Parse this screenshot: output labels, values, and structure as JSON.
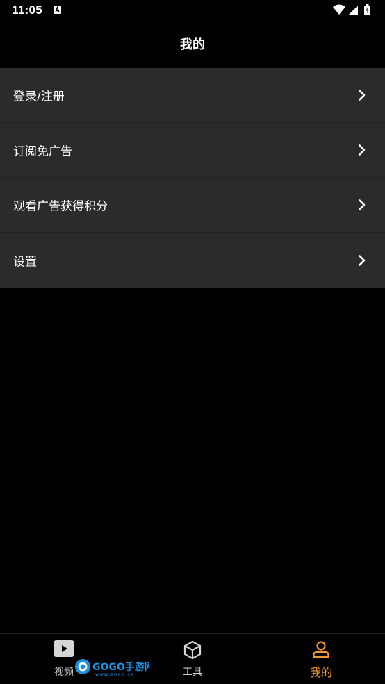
{
  "status_bar": {
    "time": "11:05",
    "notification_icon": "a-notification-icon",
    "wifi_icon": "wifi-icon",
    "signal_icon": "signal-icon",
    "battery_icon": "battery-charging-icon"
  },
  "header": {
    "title": "我的"
  },
  "menu": {
    "items": [
      {
        "label": "登录/注册",
        "icon": "chevron-right-icon"
      },
      {
        "label": "订阅免广告",
        "icon": "chevron-right-icon"
      },
      {
        "label": "观看广告获得积分",
        "icon": "chevron-right-icon"
      },
      {
        "label": "设置",
        "icon": "chevron-right-icon"
      }
    ]
  },
  "bottom_nav": {
    "items": [
      {
        "label": "视频",
        "icon": "play-video-icon",
        "active": false
      },
      {
        "label": "工具",
        "icon": "cube-icon",
        "active": false
      },
      {
        "label": "我的",
        "icon": "person-icon",
        "active": true
      }
    ]
  },
  "watermark": {
    "text": "GOGO手游网",
    "url_text": "WWW.GOGO.CN"
  },
  "colors": {
    "background": "#000000",
    "menu_background": "#2b2b2b",
    "accent": "#f39a2e",
    "text": "#ffffff"
  }
}
